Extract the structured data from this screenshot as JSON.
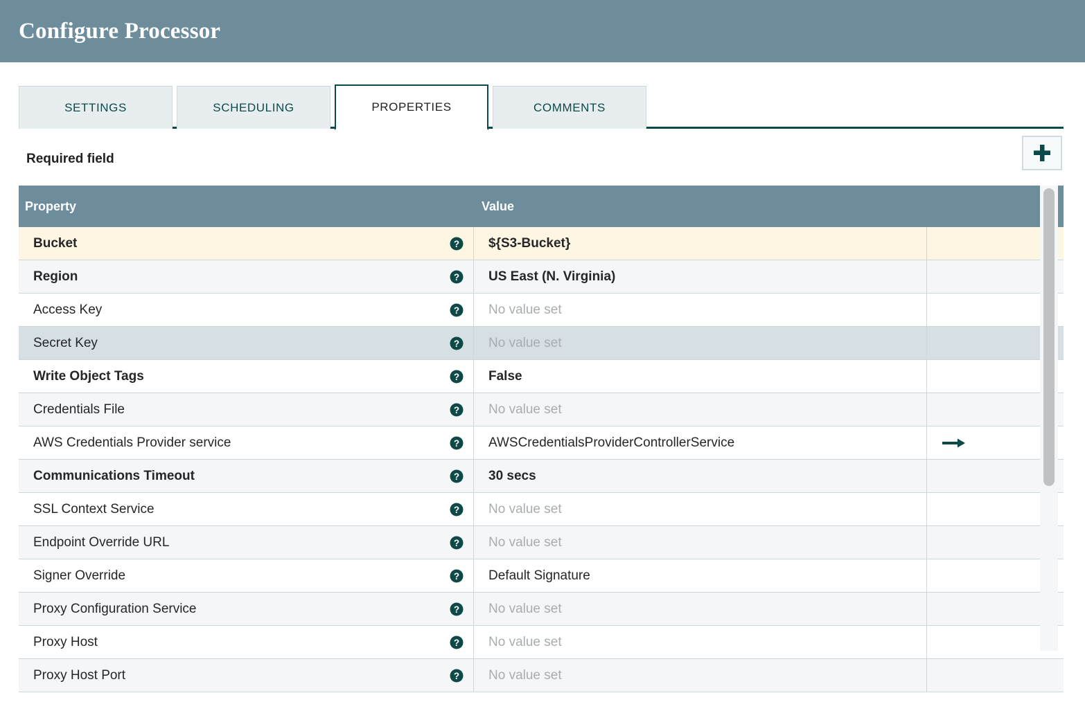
{
  "window": {
    "title": "Configure Processor"
  },
  "tabs": [
    {
      "label": "SETTINGS",
      "active": false
    },
    {
      "label": "SCHEDULING",
      "active": false
    },
    {
      "label": "PROPERTIES",
      "active": true
    },
    {
      "label": "COMMENTS",
      "active": false
    }
  ],
  "toolbar": {
    "required_field_label": "Required field",
    "add_property_label": "+",
    "add_icon": "plus-icon"
  },
  "table": {
    "columns": [
      "Property",
      "Value"
    ],
    "help_icon": "help-circle-icon",
    "go_to_icon": "arrow-right-icon",
    "placeholder_text": "No value set",
    "rows": [
      {
        "property": "Bucket",
        "value": "${S3-Bucket}",
        "bold": true,
        "required": true,
        "selected": false,
        "placeholder": false,
        "action": false
      },
      {
        "property": "Region",
        "value": "US East (N. Virginia)",
        "bold": true,
        "required": false,
        "selected": false,
        "placeholder": false,
        "action": false
      },
      {
        "property": "Access Key",
        "value": "No value set",
        "bold": false,
        "required": false,
        "selected": false,
        "placeholder": true,
        "action": false
      },
      {
        "property": "Secret Key",
        "value": "No value set",
        "bold": false,
        "required": false,
        "selected": true,
        "placeholder": true,
        "action": false
      },
      {
        "property": "Write Object Tags",
        "value": "False",
        "bold": true,
        "required": false,
        "selected": false,
        "placeholder": false,
        "action": false
      },
      {
        "property": "Credentials File",
        "value": "No value set",
        "bold": false,
        "required": false,
        "selected": false,
        "placeholder": true,
        "action": false
      },
      {
        "property": "AWS Credentials Provider service",
        "value": "AWSCredentialsProviderControllerService",
        "bold": false,
        "required": false,
        "selected": false,
        "placeholder": false,
        "action": true
      },
      {
        "property": "Communications Timeout",
        "value": "30 secs",
        "bold": true,
        "required": false,
        "selected": false,
        "placeholder": false,
        "action": false
      },
      {
        "property": "SSL Context Service",
        "value": "No value set",
        "bold": false,
        "required": false,
        "selected": false,
        "placeholder": true,
        "action": false
      },
      {
        "property": "Endpoint Override URL",
        "value": "No value set",
        "bold": false,
        "required": false,
        "selected": false,
        "placeholder": true,
        "action": false
      },
      {
        "property": "Signer Override",
        "value": "Default Signature",
        "bold": false,
        "required": false,
        "selected": false,
        "placeholder": false,
        "action": false
      },
      {
        "property": "Proxy Configuration Service",
        "value": "No value set",
        "bold": false,
        "required": false,
        "selected": false,
        "placeholder": true,
        "action": false
      },
      {
        "property": "Proxy Host",
        "value": "No value set",
        "bold": false,
        "required": false,
        "selected": false,
        "placeholder": true,
        "action": false
      },
      {
        "property": "Proxy Host Port",
        "value": "No value set",
        "bold": false,
        "required": false,
        "selected": false,
        "placeholder": true,
        "action": false
      }
    ]
  },
  "colors": {
    "header_bar": "#6d8d9c",
    "accent_teal": "#0b4a4a",
    "required_row": "#fdf6e3",
    "selected_row": "#d6dfe3",
    "alt_row": "#f4f6f7",
    "placeholder_text": "#a8adb0"
  },
  "scrollbar": {
    "orientation": "vertical",
    "thumb_position_percent": 0
  }
}
